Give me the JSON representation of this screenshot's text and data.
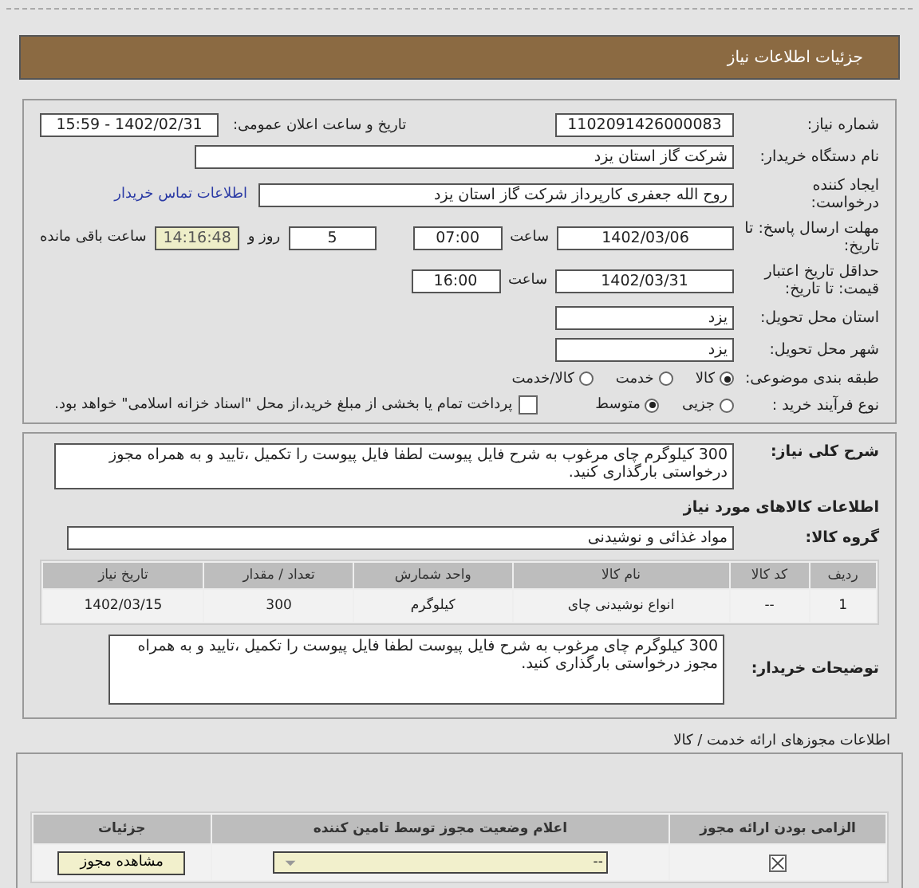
{
  "header": {
    "title": "جزئیات اطلاعات نیاز"
  },
  "need_number": {
    "label": "شماره نیاز:",
    "value": "1102091426000083"
  },
  "announce_datetime": {
    "label": "تاریخ و ساعت اعلان عمومی:",
    "value": "1402/02/31 - 15:59"
  },
  "buyer_org": {
    "label": "نام دستگاه خریدار:",
    "value": "شرکت گاز استان یزد"
  },
  "requester": {
    "label": "ایجاد کننده درخواست:",
    "value": "روح الله جعفری کارپرداز شرکت گاز استان یزد",
    "link": "اطلاعات تماس خریدار"
  },
  "response_deadline": {
    "label": "مهلت ارسال پاسخ: تا تاریخ:",
    "date": "1402/03/06",
    "time_label": "ساعت",
    "time": "07:00",
    "days": "5",
    "days_label": "روز و",
    "remaining": "14:16:48",
    "remaining_label": "ساعت باقی مانده"
  },
  "price_validity": {
    "label": "حداقل تاریخ اعتبار قیمت: تا تاریخ:",
    "date": "1402/03/31",
    "time_label": "ساعت",
    "time": "16:00"
  },
  "delivery_province": {
    "label": "استان محل تحویل:",
    "value": "یزد"
  },
  "delivery_city": {
    "label": "شهر محل تحویل:",
    "value": "یزد"
  },
  "subject_category": {
    "label": "طبقه بندی موضوعی:",
    "options": [
      {
        "label": "کالا",
        "selected": true
      },
      {
        "label": "خدمت",
        "selected": false
      },
      {
        "label": "کالا/خدمت",
        "selected": false
      }
    ]
  },
  "purchase_process": {
    "label": "نوع فرآیند خرید :",
    "options": [
      {
        "label": "جزیی",
        "selected": false
      },
      {
        "label": "متوسط",
        "selected": true
      }
    ],
    "treasury": {
      "label": "پرداخت تمام یا بخشی از مبلغ خرید،از محل \"اسناد خزانه اسلامی\" خواهد بود.",
      "checked": false
    }
  },
  "general_description": {
    "label": "شرح کلی نیاز:",
    "value": "300 کیلوگرم چای مرغوب به شرح فایل پیوست لطفا فایل پیوست را تکمیل ،تایید و به همراه مجوز درخواستی بارگذاری کنید."
  },
  "goods_heading": "اطلاعات کالاهای مورد نیاز",
  "goods_group": {
    "label": "گروه کالا:",
    "value": "مواد غذائی و نوشیدنی"
  },
  "goods_table": {
    "columns": [
      "ردیف",
      "کد کالا",
      "نام کالا",
      "واحد شمارش",
      "تعداد / مقدار",
      "تاریخ نیاز"
    ],
    "rows": [
      [
        "1",
        "--",
        "انواع نوشیدنی چای",
        "کیلوگرم",
        "300",
        "1402/03/15"
      ]
    ]
  },
  "buyer_notes": {
    "label": "توضیحات خریدار:",
    "value": "300 کیلوگرم چای مرغوب به شرح فایل پیوست لطفا فایل پیوست را تکمیل ،تایید و به همراه مجوز درخواستی بارگذاری کنید."
  },
  "licenses": {
    "title": "اطلاعات مجوزهای ارائه خدمت / کالا",
    "columns": [
      "الزامی بودن ارائه مجوز",
      "اعلام وضعیت مجوز توسط تامین کننده",
      "جزئیات"
    ],
    "rows": [
      {
        "required": true,
        "status": "--",
        "button": "مشاهده مجوز"
      }
    ]
  }
}
